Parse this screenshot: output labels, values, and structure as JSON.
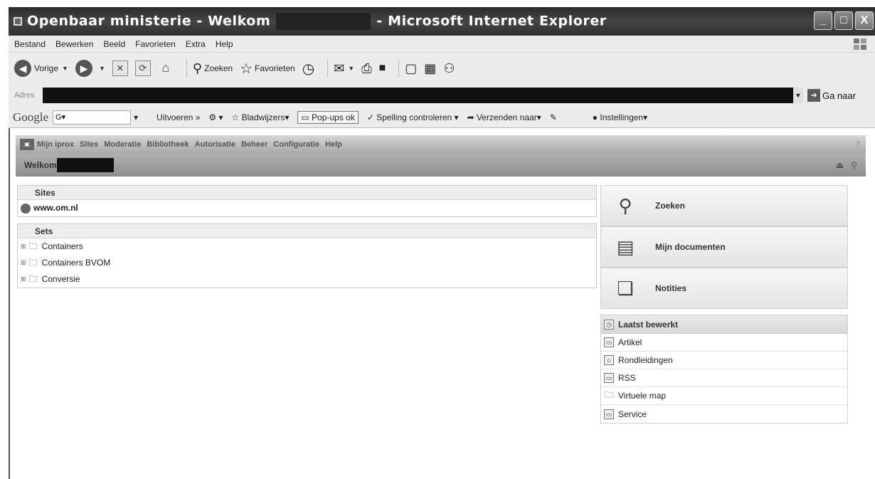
{
  "window": {
    "title_prefix": "Openbaar ministerie - Welkom",
    "title_suffix": "- Microsoft Internet Explorer",
    "buttons": [
      "_",
      "□",
      "X"
    ]
  },
  "menubar": {
    "items": [
      "Bestand",
      "Bewerken",
      "Beeld",
      "Favorieten",
      "Extra",
      "Help"
    ]
  },
  "navbar": {
    "back_label": "Vorige",
    "search_label": "Zoeken",
    "favorites_label": "Favorieten"
  },
  "address": {
    "label": "Adres",
    "go_label": "Ga naar"
  },
  "google_toolbar": {
    "logo": "Google",
    "search_prefix": "G▾",
    "run_label": "Uitvoeren »",
    "bookmarks_label": "Bladwijzers▾",
    "popups_label": "Pop-ups ok",
    "spell_label": "Spelling controleren ▾",
    "send_label": "Verzenden naar▾",
    "settings_label": "Instellingen▾"
  },
  "portal": {
    "menu": [
      "Mijn iprox",
      "Sites",
      "Moderatie",
      "Bibliotheek",
      "Autorisatie",
      "Beheer",
      "Configuratie",
      "Help"
    ],
    "welcome_label": "Welkom"
  },
  "sites_panel": {
    "header": "Sites",
    "items": [
      "www.om.nl"
    ]
  },
  "sets_panel": {
    "header": "Sets",
    "items": [
      "Containers",
      "Containers BVOM",
      "Conversie"
    ]
  },
  "right_actions": [
    {
      "label": "Zoeken",
      "icon": "magnifier-icon"
    },
    {
      "label": "Mijn documenten",
      "icon": "documents-icon"
    },
    {
      "label": "Notities",
      "icon": "notes-icon"
    }
  ],
  "recent_panel": {
    "header": "Laatst bewerkt",
    "items": [
      "Artikel",
      "Rondleidingen",
      "RSS",
      "Virtuele map",
      "Service"
    ]
  }
}
